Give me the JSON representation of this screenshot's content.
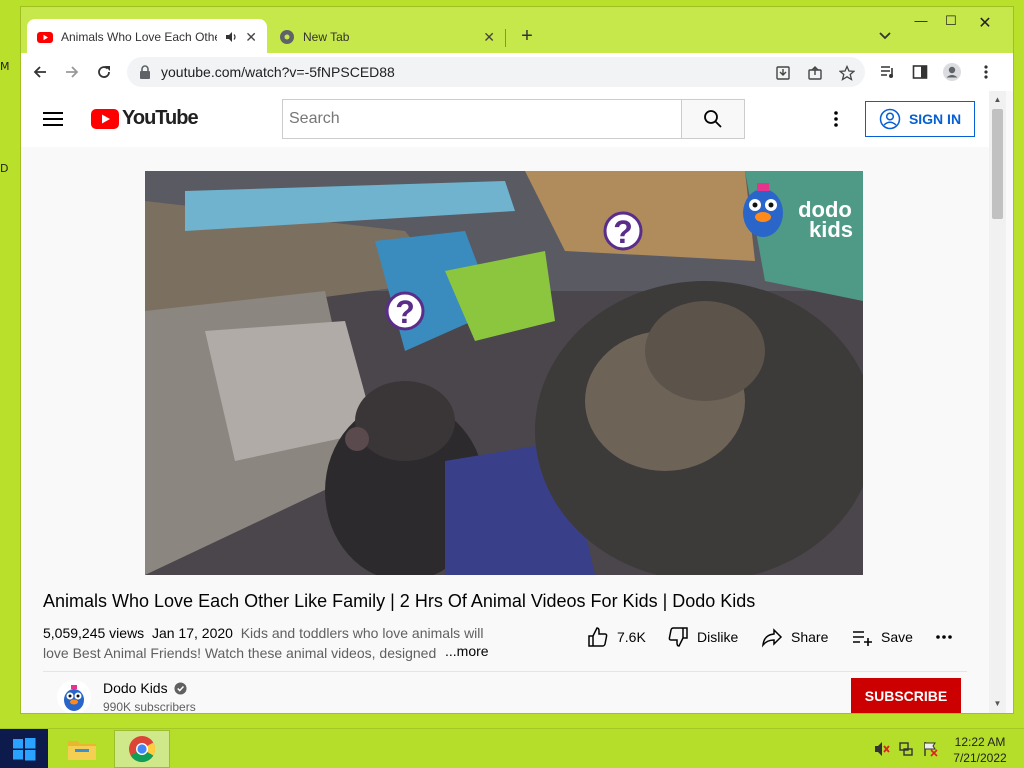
{
  "desktop": {
    "edge_chars": [
      "M",
      "D"
    ]
  },
  "browser": {
    "tabs": [
      {
        "title": "Animals Who Love Each Other Like Family",
        "active": true
      },
      {
        "title": "New Tab",
        "active": false
      }
    ],
    "new_tab": "+",
    "address": "youtube.com/watch?v=-5fNPSCED88"
  },
  "youtube": {
    "logo_text": "YouTube",
    "search_placeholder": "Search",
    "sign_in": "SIGN IN",
    "video": {
      "overlay_brand_1": "dodo",
      "overlay_brand_2": "kids",
      "question_mark": "?"
    },
    "title": "Animals Who Love Each Other Like Family | 2 Hrs Of Animal Videos For Kids | Dodo Kids",
    "views": "5,059,245 views",
    "date": "Jan 17, 2020",
    "description": "Kids and toddlers who love animals will love Best Animal Friends! Watch these animal videos, designed",
    "more": "...more",
    "actions": {
      "likes": "7.6K",
      "dislike": "Dislike",
      "share": "Share",
      "save": "Save"
    },
    "channel": {
      "name": "Dodo Kids",
      "subscribers": "990K subscribers",
      "subscribe": "SUBSCRIBE"
    }
  },
  "taskbar": {
    "time": "12:22 AM",
    "date": "7/21/2022"
  },
  "colors": {
    "accent_red": "#ff0000",
    "subscribe_red": "#cc0000",
    "link_blue": "#065fd4",
    "desktop_green": "#b9e02a"
  }
}
